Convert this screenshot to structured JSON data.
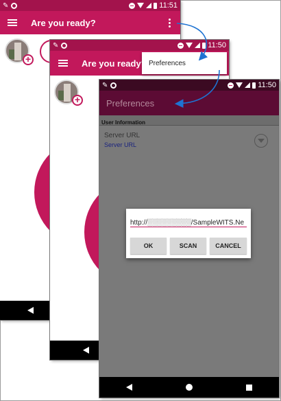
{
  "screen1": {
    "status_time": "11:51",
    "title": "Are you ready?"
  },
  "screen2": {
    "status_time": "11:50",
    "title": "Are you ready?",
    "menu_item": "Preferences"
  },
  "screen3": {
    "status_time": "11:50",
    "title": "Preferences",
    "section_header": "User Information",
    "pref_title": "Server URL",
    "pref_summary": "Server URL",
    "dialog": {
      "url_value": "http://░░░░░░░░░/SampleWITS.Ne",
      "buttons": [
        "OK",
        "SCAN",
        "CANCEL"
      ]
    }
  },
  "colors": {
    "primary": "#c2185b",
    "primary_dark": "#880e4f",
    "accent_arrow": "#1e73d2"
  }
}
